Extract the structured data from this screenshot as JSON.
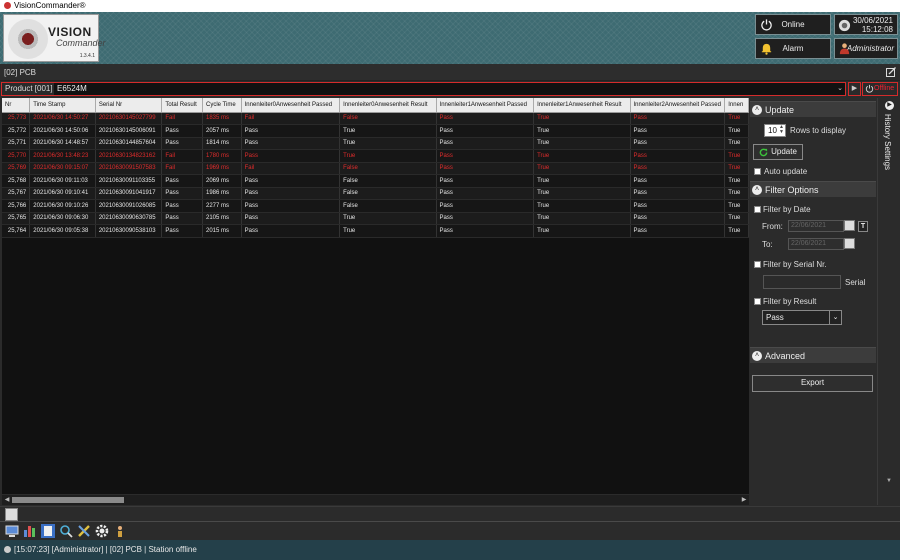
{
  "app": {
    "title": "VisionCommander®"
  },
  "logo": {
    "line1": "VISION",
    "line2": "Commander",
    "version": "1.3.4.1"
  },
  "header": {
    "online_label": "Online",
    "alarm_label": "Alarm",
    "date": "30/06/2021",
    "time": "15:12:08",
    "user": "Administrator"
  },
  "station": {
    "name": "[02] PCB"
  },
  "product": {
    "label": "Product [001]",
    "value": "E6524M",
    "offline_label": "Offline"
  },
  "table": {
    "columns": [
      "Nr",
      "Time Stamp",
      "Serial Nr",
      "Total Result",
      "Cycle Time",
      "Innenleiter0Anwesenheit Passed",
      "Innenleiter0Anwesenheit Result",
      "Innenleiter1Anwesenheit Passed",
      "Innenleiter1Anwesenheit Result",
      "Innenleiter2Anwesenheit Passed",
      "Innen"
    ],
    "rows": [
      {
        "fail": true,
        "cells": [
          "25,773",
          "2021/06/30 14:50:27",
          "20210630145027799",
          "Fail",
          "1835 ms",
          "Fail",
          "False",
          "Pass",
          "True",
          "Pass",
          "True"
        ]
      },
      {
        "fail": false,
        "cells": [
          "25,772",
          "2021/06/30 14:50:06",
          "20210630145006091",
          "Pass",
          "2057 ms",
          "Pass",
          "True",
          "Pass",
          "True",
          "Pass",
          "True"
        ]
      },
      {
        "fail": false,
        "cells": [
          "25,771",
          "2021/06/30 14:48:57",
          "20210630144857604",
          "Pass",
          "1814 ms",
          "Pass",
          "True",
          "Pass",
          "True",
          "Pass",
          "True"
        ]
      },
      {
        "fail": true,
        "cells": [
          "25,770",
          "2021/06/30 13:48:23",
          "20210630134823162",
          "Fail",
          "1780 ms",
          "Pass",
          "True",
          "Pass",
          "True",
          "Pass",
          "True"
        ]
      },
      {
        "fail": true,
        "cells": [
          "25,769",
          "2021/06/30 09:15:07",
          "20210630091507583",
          "Fail",
          "1969 ms",
          "Fail",
          "False",
          "Pass",
          "True",
          "Pass",
          "True"
        ]
      },
      {
        "fail": false,
        "cells": [
          "25,768",
          "2021/06/30 09:11:03",
          "20210630091103355",
          "Pass",
          "2069 ms",
          "Pass",
          "False",
          "Pass",
          "True",
          "Pass",
          "True"
        ]
      },
      {
        "fail": false,
        "cells": [
          "25,767",
          "2021/06/30 09:10:41",
          "20210630091041917",
          "Pass",
          "1986 ms",
          "Pass",
          "False",
          "Pass",
          "True",
          "Pass",
          "True"
        ]
      },
      {
        "fail": false,
        "cells": [
          "25,766",
          "2021/06/30 09:10:26",
          "20210630091026085",
          "Pass",
          "2277 ms",
          "Pass",
          "False",
          "Pass",
          "True",
          "Pass",
          "True"
        ]
      },
      {
        "fail": false,
        "cells": [
          "25,765",
          "2021/06/30 09:06:30",
          "20210630090630785",
          "Pass",
          "2105 ms",
          "Pass",
          "True",
          "Pass",
          "True",
          "Pass",
          "True"
        ]
      },
      {
        "fail": false,
        "cells": [
          "25,764",
          "2021/06/30 09:05:38",
          "20210630090538103",
          "Pass",
          "2015 ms",
          "Pass",
          "True",
          "Pass",
          "True",
          "Pass",
          "True"
        ]
      }
    ]
  },
  "panel": {
    "update_header": "Update",
    "rows_value": "10",
    "rows_label": "Rows to display",
    "update_button": "Update",
    "auto_update": "Auto update",
    "filter_header": "Filter Options",
    "filter_date": "Filter by Date",
    "from_label": "From:",
    "from_value": "22/06/2021",
    "to_label": "To:",
    "to_value": "22/06/2021",
    "today_button": "T",
    "filter_serial": "Filter by Serial Nr.",
    "serial_label": "Serial",
    "filter_result": "Filter by Result",
    "result_value": "Pass",
    "advanced_header": "Advanced",
    "export_button": "Export",
    "history_tab": "History Settings"
  },
  "status": {
    "text": "[15:07:23] [Administrator] | [02] PCB | Station offline"
  },
  "colors": {
    "fail": "#e02c2c",
    "header_teal": "#3e6b72",
    "status_bar": "#24404a",
    "highlight_border": "#d42b2b"
  }
}
